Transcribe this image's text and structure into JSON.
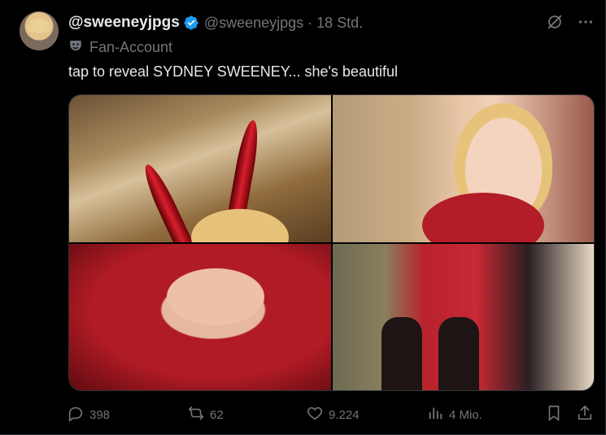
{
  "tweet": {
    "display_name": "@sweeneyjpgs",
    "handle": "@sweeneyjpgs",
    "separator": "·",
    "time": "18 Std.",
    "label": "Fan-Account",
    "text": "tap to reveal SYDNEY SWEENEY... she's beautiful"
  },
  "icons": {
    "verified": "verified-badge-icon",
    "grok": "grok-icon",
    "more": "more-icon",
    "label": "fan-account-mask-icon"
  },
  "media": {
    "tiles": 4
  },
  "actions": {
    "replies": "398",
    "reposts": "62",
    "likes": "9.224",
    "views": "4 Mio."
  },
  "colors": {
    "background": "#000000",
    "text": "#e7e9ea",
    "muted": "#71767b",
    "accent": "#1d9bf0",
    "border": "#2f3336"
  }
}
